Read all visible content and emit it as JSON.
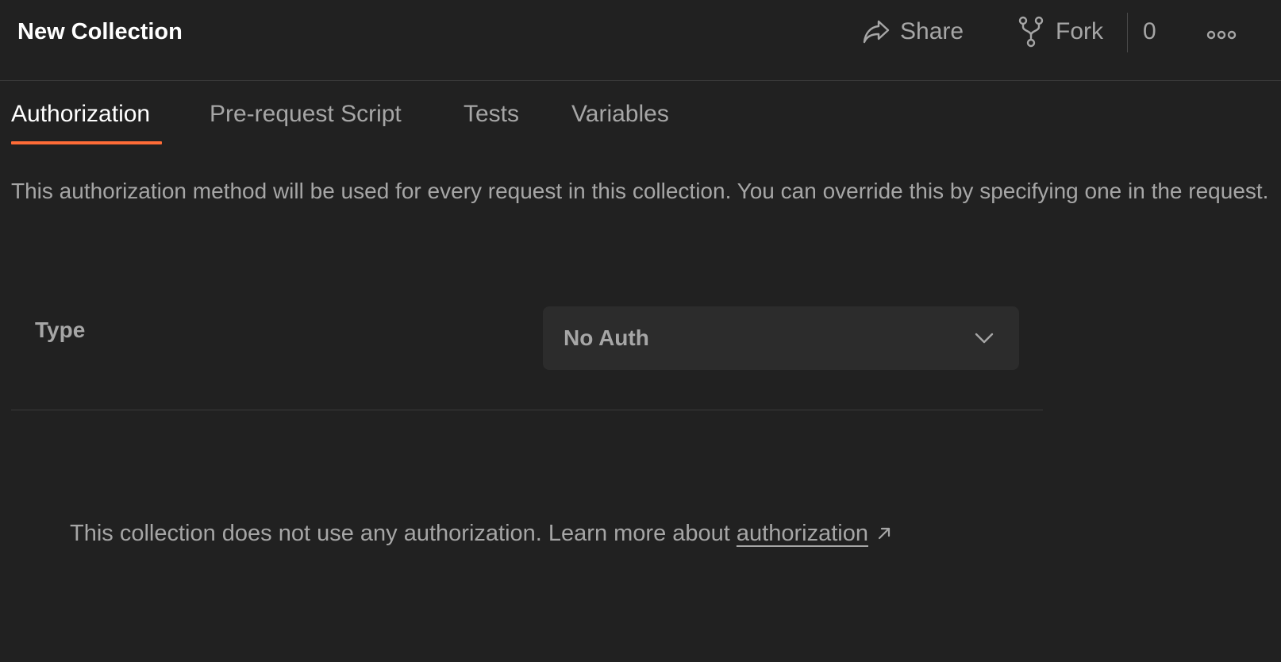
{
  "header": {
    "title": "New Collection",
    "share_label": "Share",
    "fork_label": "Fork",
    "fork_count": "0",
    "icons": {
      "share": "share-arrow-icon",
      "fork": "fork-icon",
      "more": "more-horizontal-icon"
    }
  },
  "tabs": [
    {
      "label": "Authorization",
      "active": true
    },
    {
      "label": "Pre-request Script",
      "active": false
    },
    {
      "label": "Tests",
      "active": false
    },
    {
      "label": "Variables",
      "active": false
    }
  ],
  "auth": {
    "description": "This authorization method will be used for every request in this collection. You can override this by specifying one in the request.",
    "type_label": "Type",
    "type_value": "No Auth",
    "info_text": "This collection does not use any authorization. Learn more about ",
    "info_link": "authorization"
  },
  "colors": {
    "background": "#212121",
    "accent": "#ff6c37",
    "text": "#a6a6a6",
    "text_active": "#ffffff",
    "select_bg": "#2c2c2c"
  }
}
